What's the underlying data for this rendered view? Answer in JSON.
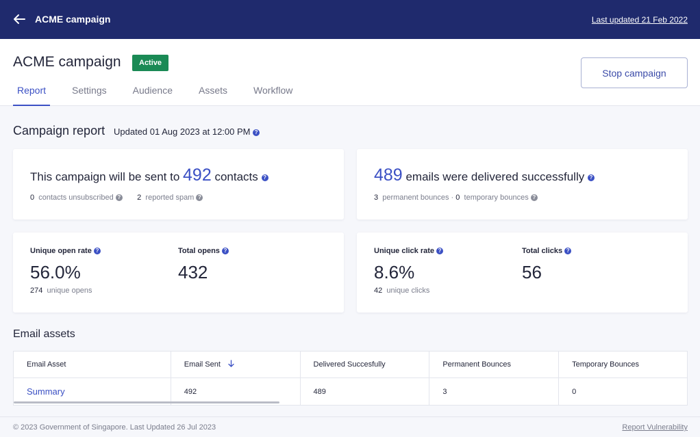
{
  "topbar": {
    "back_icon": "arrow-left-icon",
    "title": "ACME campaign",
    "last_updated": "Last updated 21 Feb 2022"
  },
  "header": {
    "title": "ACME campaign",
    "status": "Active",
    "status_color": "#1a8a55",
    "stop_button": "Stop campaign",
    "tabs": [
      {
        "label": "Report",
        "active": true
      },
      {
        "label": "Settings",
        "active": false
      },
      {
        "label": "Audience",
        "active": false
      },
      {
        "label": "Assets",
        "active": false
      },
      {
        "label": "Workflow",
        "active": false
      }
    ]
  },
  "report": {
    "title": "Campaign report",
    "updated": "Updated 01 Aug 2023 at 12:00 PM",
    "help_icon": "question-circle-icon"
  },
  "contacts_card": {
    "prefix": "This campaign will be sent to",
    "count": "492",
    "suffix": "contacts",
    "unsubscribed_count": "0",
    "unsubscribed_label": "contacts unsubscribed",
    "spam_count": "2",
    "spam_label": "reported spam"
  },
  "delivered_card": {
    "count": "489",
    "suffix": "emails were delivered successfully",
    "permanent_count": "3",
    "permanent_label": "permanent bounces",
    "separator": "·",
    "temporary_count": "0",
    "temporary_label": "temporary bounces"
  },
  "opens_card": {
    "rate_label": "Unique open rate",
    "rate_value": "56.0%",
    "unique_count": "274",
    "unique_label": "unique opens",
    "total_label": "Total opens",
    "total_value": "432"
  },
  "clicks_card": {
    "rate_label": "Unique click rate",
    "rate_value": "8.6%",
    "unique_count": "42",
    "unique_label": "unique clicks",
    "total_label": "Total clicks",
    "total_value": "56"
  },
  "assets": {
    "title": "Email assets",
    "columns": [
      "Email Asset",
      "Email Sent",
      "Delivered Succesfully",
      "Permanent Bounces",
      "Temporary Bounces"
    ],
    "sort_icon": "arrow-down-icon",
    "rows": [
      [
        "Summary",
        "492",
        "489",
        "3",
        "0"
      ]
    ]
  },
  "footer": {
    "copyright": "© 2023 Government of Singapore. Last Updated 26 Jul 2023",
    "report_link": "Report Vulnerability"
  },
  "colors": {
    "topbar": "#1f2a6d",
    "accent": "#3b50c4"
  }
}
